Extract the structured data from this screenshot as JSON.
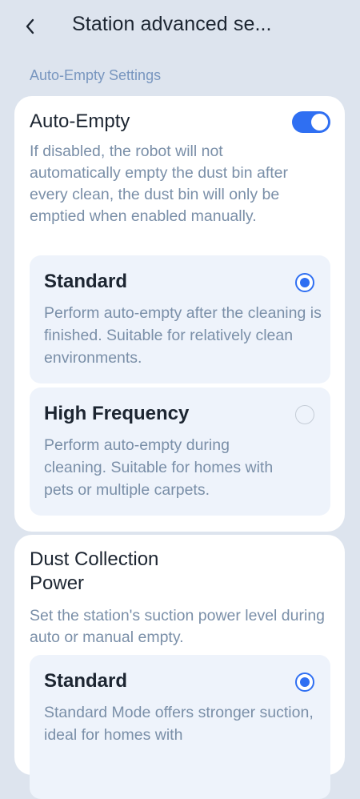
{
  "header": {
    "title": "Station advanced se..."
  },
  "section_label": "Auto-Empty Settings",
  "auto_empty_card": {
    "title": "Auto-Empty",
    "toggle_on": true,
    "description": "If disabled, the robot will not automatically empty the dust bin after every clean, the dust bin will only be emptied when enabled manually.",
    "options": [
      {
        "title": "Standard",
        "description": "Perform auto-empty after the cleaning is finished. Suitable for relatively clean environments.",
        "selected": true
      },
      {
        "title": "High Frequency",
        "description": "Perform auto-empty during cleaning. Suitable for homes with pets or multiple carpets.",
        "selected": false
      }
    ]
  },
  "dust_power_card": {
    "title_line1": "Dust Collection",
    "title_line2": "Power",
    "description": "Set the station's suction power level during auto or manual empty.",
    "options": [
      {
        "title": "Standard",
        "description": "Standard Mode offers stronger suction, ideal for homes with",
        "selected": true
      }
    ]
  },
  "colors": {
    "accent": "#2f6ff2",
    "background": "#dde4ee",
    "muted_text": "#7a8fa8",
    "section_label": "#7896bf"
  }
}
